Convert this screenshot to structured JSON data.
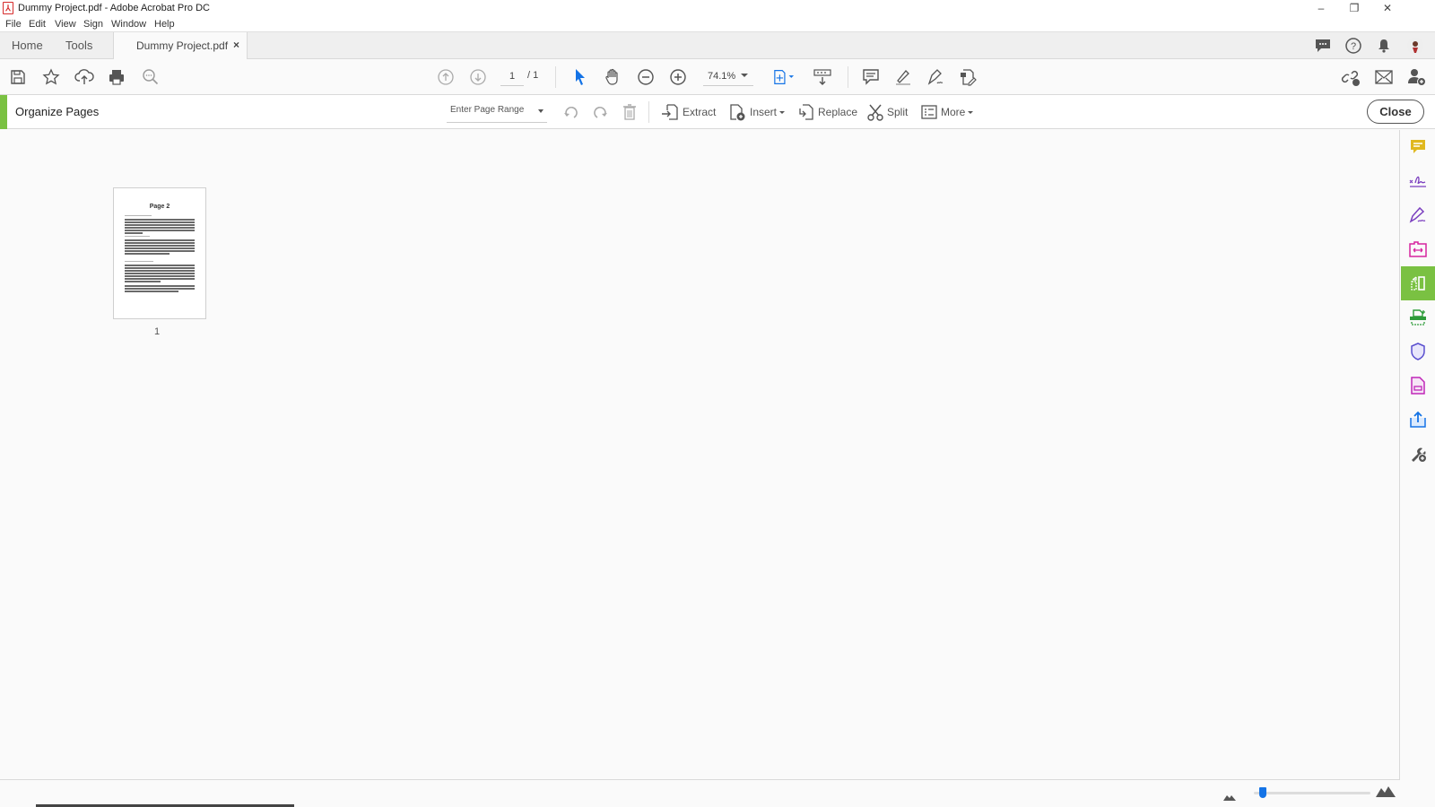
{
  "window": {
    "title": "Dummy Project.pdf - Adobe Acrobat Pro DC",
    "controls": {
      "minimize": "–",
      "restore": "❐",
      "close": "✕"
    }
  },
  "menu": [
    "File",
    "Edit",
    "View",
    "Sign",
    "Window",
    "Help"
  ],
  "tabs": {
    "home": "Home",
    "tools": "Tools",
    "document": "Dummy Project.pdf",
    "document_close": "×"
  },
  "header_icons": [
    "comments-icon",
    "help-icon",
    "notifications-icon",
    "profile-avatar"
  ],
  "toolbar": {
    "left_icons": [
      "save-icon",
      "bookmark-star-icon",
      "cloud-upload-icon",
      "print-icon",
      "search-text-icon"
    ],
    "page_current": "1",
    "page_total": "/ 1",
    "zoom_level": "74.1%",
    "tool_icons": [
      "prev-page-icon",
      "next-page-icon",
      "select-cursor-icon",
      "hand-icon",
      "zoom-out-icon",
      "zoom-in-icon",
      "fit-page-icon",
      "scroll-mode-icon",
      "comment-icon",
      "highlight-icon",
      "sign-icon",
      "fill-sign-icon"
    ],
    "right_icons": [
      "share-link-icon",
      "email-icon",
      "add-user-icon"
    ]
  },
  "organize": {
    "title": "Organize Pages",
    "range_placeholder": "Enter Page Range",
    "buttons": {
      "extract": "Extract",
      "insert": "Insert",
      "replace": "Replace",
      "split": "Split",
      "more": "More",
      "close": "Close"
    }
  },
  "thumbnail": {
    "page_heading": "Page 2",
    "page_number": "1"
  },
  "right_rail": [
    "comment-tool-icon",
    "fill-sign-tool-icon",
    "request-signature-icon",
    "edit-pdf-icon",
    "organize-pages-icon",
    "scan-icon",
    "protect-icon",
    "create-pdf-icon",
    "export-pdf-icon",
    "more-tools-icon"
  ],
  "status": {
    "thumbnail_size_fraction": 0.05
  },
  "colors": {
    "accent_green": "#7ac142",
    "accent_blue": "#1473e6"
  }
}
